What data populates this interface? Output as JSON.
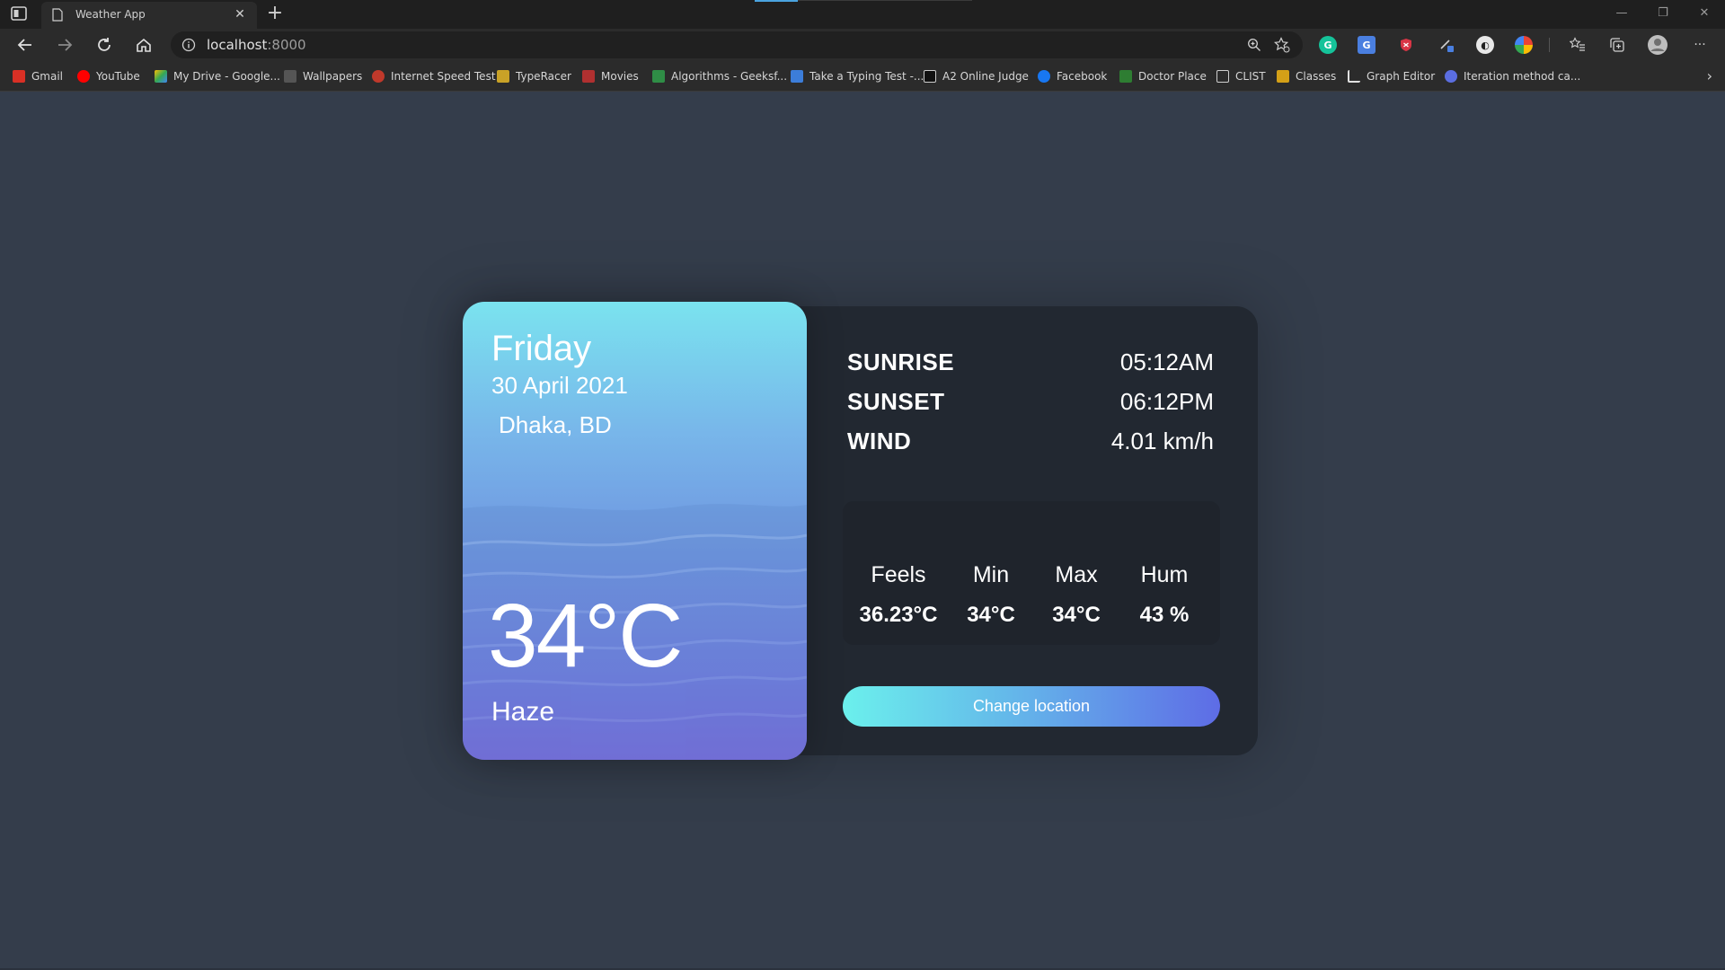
{
  "browser": {
    "tab_title": "Weather App",
    "address": "localhost",
    "address_port": ":8000",
    "bookmarks": [
      {
        "label": "Gmail",
        "color": "#d93025"
      },
      {
        "label": "YouTube",
        "color": "#ff0000"
      },
      {
        "label": "My Drive - Google...",
        "color": "#34a853"
      },
      {
        "label": "Wallpapers",
        "color": "#555555"
      },
      {
        "label": "Internet Speed Test",
        "color": "#c0392b"
      },
      {
        "label": "TypeRacer",
        "color": "#c9a227"
      },
      {
        "label": "Movies",
        "color": "#b03030"
      },
      {
        "label": "Algorithms - Geeksf...",
        "color": "#2f8d46"
      },
      {
        "label": "Take a Typing Test -...",
        "color": "#3c7dd9"
      },
      {
        "label": "A2 Online Judge",
        "color": "#111111"
      },
      {
        "label": "Facebook",
        "color": "#1877f2"
      },
      {
        "label": "Doctor Place",
        "color": "#2e7d32"
      },
      {
        "label": "CLIST",
        "color": "#777777"
      },
      {
        "label": "Classes",
        "color": "#d4a017"
      },
      {
        "label": "Graph Editor",
        "color": "#e0e0e0"
      },
      {
        "label": "Iteration method ca...",
        "color": "#5b6ee1"
      }
    ]
  },
  "weather": {
    "day": "Friday",
    "date": "30 April 2021",
    "location": "Dhaka, BD",
    "temperature": "34°C",
    "condition": "Haze",
    "details": [
      {
        "label": "SUNRISE",
        "value": "05:12AM"
      },
      {
        "label": "SUNSET",
        "value": "06:12PM"
      },
      {
        "label": "WIND",
        "value": "4.01 km/h"
      }
    ],
    "stats": [
      {
        "label": "Feels",
        "value": "36.23°C"
      },
      {
        "label": "Min",
        "value": "34°C"
      },
      {
        "label": "Max",
        "value": "34°C"
      },
      {
        "label": "Hum",
        "value": "43 %"
      }
    ],
    "change_location_label": "Change location"
  }
}
